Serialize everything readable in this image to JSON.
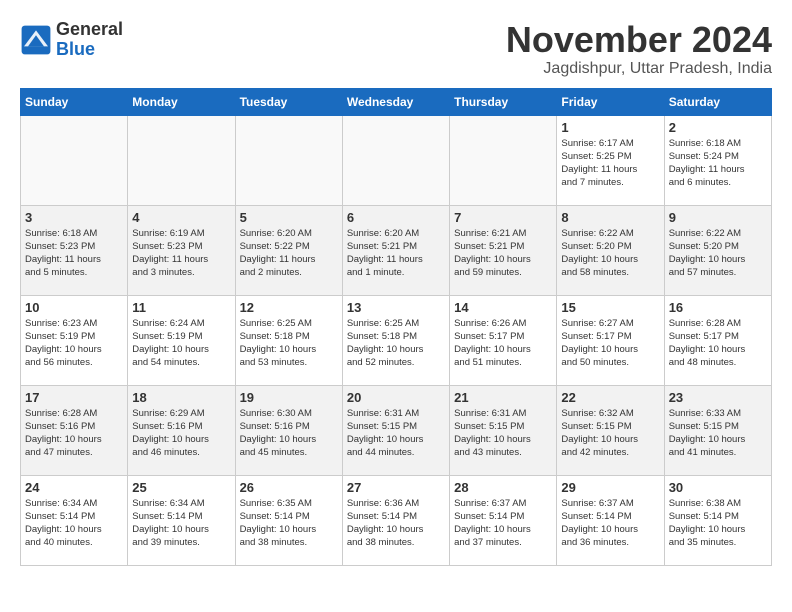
{
  "header": {
    "logo_line1": "General",
    "logo_line2": "Blue",
    "month": "November 2024",
    "location": "Jagdishpur, Uttar Pradesh, India"
  },
  "weekdays": [
    "Sunday",
    "Monday",
    "Tuesday",
    "Wednesday",
    "Thursday",
    "Friday",
    "Saturday"
  ],
  "weeks": [
    [
      {
        "day": "",
        "info": ""
      },
      {
        "day": "",
        "info": ""
      },
      {
        "day": "",
        "info": ""
      },
      {
        "day": "",
        "info": ""
      },
      {
        "day": "",
        "info": ""
      },
      {
        "day": "1",
        "info": "Sunrise: 6:17 AM\nSunset: 5:25 PM\nDaylight: 11 hours\nand 7 minutes."
      },
      {
        "day": "2",
        "info": "Sunrise: 6:18 AM\nSunset: 5:24 PM\nDaylight: 11 hours\nand 6 minutes."
      }
    ],
    [
      {
        "day": "3",
        "info": "Sunrise: 6:18 AM\nSunset: 5:23 PM\nDaylight: 11 hours\nand 5 minutes."
      },
      {
        "day": "4",
        "info": "Sunrise: 6:19 AM\nSunset: 5:23 PM\nDaylight: 11 hours\nand 3 minutes."
      },
      {
        "day": "5",
        "info": "Sunrise: 6:20 AM\nSunset: 5:22 PM\nDaylight: 11 hours\nand 2 minutes."
      },
      {
        "day": "6",
        "info": "Sunrise: 6:20 AM\nSunset: 5:21 PM\nDaylight: 11 hours\nand 1 minute."
      },
      {
        "day": "7",
        "info": "Sunrise: 6:21 AM\nSunset: 5:21 PM\nDaylight: 10 hours\nand 59 minutes."
      },
      {
        "day": "8",
        "info": "Sunrise: 6:22 AM\nSunset: 5:20 PM\nDaylight: 10 hours\nand 58 minutes."
      },
      {
        "day": "9",
        "info": "Sunrise: 6:22 AM\nSunset: 5:20 PM\nDaylight: 10 hours\nand 57 minutes."
      }
    ],
    [
      {
        "day": "10",
        "info": "Sunrise: 6:23 AM\nSunset: 5:19 PM\nDaylight: 10 hours\nand 56 minutes."
      },
      {
        "day": "11",
        "info": "Sunrise: 6:24 AM\nSunset: 5:19 PM\nDaylight: 10 hours\nand 54 minutes."
      },
      {
        "day": "12",
        "info": "Sunrise: 6:25 AM\nSunset: 5:18 PM\nDaylight: 10 hours\nand 53 minutes."
      },
      {
        "day": "13",
        "info": "Sunrise: 6:25 AM\nSunset: 5:18 PM\nDaylight: 10 hours\nand 52 minutes."
      },
      {
        "day": "14",
        "info": "Sunrise: 6:26 AM\nSunset: 5:17 PM\nDaylight: 10 hours\nand 51 minutes."
      },
      {
        "day": "15",
        "info": "Sunrise: 6:27 AM\nSunset: 5:17 PM\nDaylight: 10 hours\nand 50 minutes."
      },
      {
        "day": "16",
        "info": "Sunrise: 6:28 AM\nSunset: 5:17 PM\nDaylight: 10 hours\nand 48 minutes."
      }
    ],
    [
      {
        "day": "17",
        "info": "Sunrise: 6:28 AM\nSunset: 5:16 PM\nDaylight: 10 hours\nand 47 minutes."
      },
      {
        "day": "18",
        "info": "Sunrise: 6:29 AM\nSunset: 5:16 PM\nDaylight: 10 hours\nand 46 minutes."
      },
      {
        "day": "19",
        "info": "Sunrise: 6:30 AM\nSunset: 5:16 PM\nDaylight: 10 hours\nand 45 minutes."
      },
      {
        "day": "20",
        "info": "Sunrise: 6:31 AM\nSunset: 5:15 PM\nDaylight: 10 hours\nand 44 minutes."
      },
      {
        "day": "21",
        "info": "Sunrise: 6:31 AM\nSunset: 5:15 PM\nDaylight: 10 hours\nand 43 minutes."
      },
      {
        "day": "22",
        "info": "Sunrise: 6:32 AM\nSunset: 5:15 PM\nDaylight: 10 hours\nand 42 minutes."
      },
      {
        "day": "23",
        "info": "Sunrise: 6:33 AM\nSunset: 5:15 PM\nDaylight: 10 hours\nand 41 minutes."
      }
    ],
    [
      {
        "day": "24",
        "info": "Sunrise: 6:34 AM\nSunset: 5:14 PM\nDaylight: 10 hours\nand 40 minutes."
      },
      {
        "day": "25",
        "info": "Sunrise: 6:34 AM\nSunset: 5:14 PM\nDaylight: 10 hours\nand 39 minutes."
      },
      {
        "day": "26",
        "info": "Sunrise: 6:35 AM\nSunset: 5:14 PM\nDaylight: 10 hours\nand 38 minutes."
      },
      {
        "day": "27",
        "info": "Sunrise: 6:36 AM\nSunset: 5:14 PM\nDaylight: 10 hours\nand 38 minutes."
      },
      {
        "day": "28",
        "info": "Sunrise: 6:37 AM\nSunset: 5:14 PM\nDaylight: 10 hours\nand 37 minutes."
      },
      {
        "day": "29",
        "info": "Sunrise: 6:37 AM\nSunset: 5:14 PM\nDaylight: 10 hours\nand 36 minutes."
      },
      {
        "day": "30",
        "info": "Sunrise: 6:38 AM\nSunset: 5:14 PM\nDaylight: 10 hours\nand 35 minutes."
      }
    ]
  ]
}
